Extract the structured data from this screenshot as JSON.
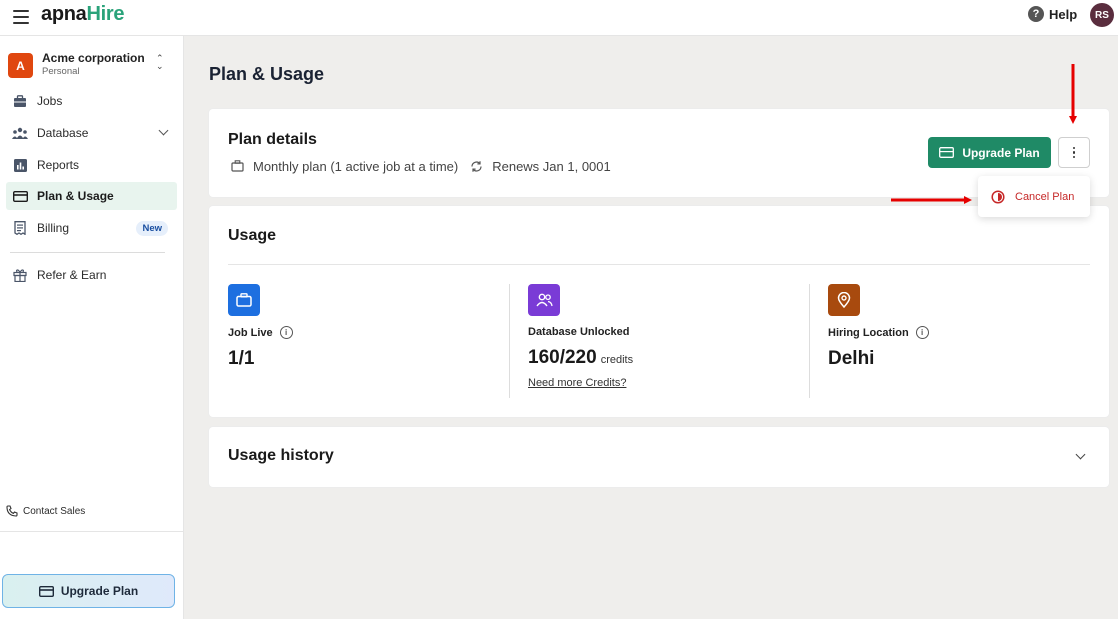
{
  "app": {
    "logo_prefix": "apna",
    "logo_suffix": "Hire",
    "help_label": "Help",
    "user_initials": "RS"
  },
  "sidebar": {
    "org": {
      "badge": "A",
      "name": "Acme corporation",
      "type": "Personal"
    },
    "items": [
      {
        "label": "Jobs",
        "icon": "briefcase-icon"
      },
      {
        "label": "Database",
        "icon": "people-icon"
      },
      {
        "label": "Reports",
        "icon": "bar-chart-icon"
      },
      {
        "label": "Plan & Usage",
        "icon": "credit-card-icon",
        "active": true
      },
      {
        "label": "Billing",
        "icon": "receipt-icon",
        "badge": "New"
      },
      {
        "label": "Refer & Earn",
        "icon": "gift-icon"
      }
    ],
    "contact_label": "Contact Sales",
    "upgrade_label": "Upgrade Plan"
  },
  "main": {
    "page_title": "Plan & Usage",
    "plan_details": {
      "title": "Plan details",
      "plan_text": "Monthly plan (1 active job at a time)",
      "renew_text": "Renews Jan 1, 0001",
      "upgrade_label": "Upgrade Plan",
      "menu": {
        "cancel_label": "Cancel Plan"
      }
    },
    "usage": {
      "title": "Usage",
      "items": [
        {
          "label": "Job Live",
          "value": "1/1",
          "color": "#1d6fe0",
          "icon": "briefcase-icon"
        },
        {
          "label": "Database Unlocked",
          "value": "160/220",
          "unit": "credits",
          "link": "Need more Credits?",
          "color": "#7a3bd6",
          "icon": "people-icon"
        },
        {
          "label": "Hiring Location",
          "value": "Delhi",
          "color": "#a84a0e",
          "icon": "location-pin-icon"
        }
      ]
    },
    "usage_history": {
      "title": "Usage history"
    }
  },
  "colors": {
    "brand_green": "#1f8a66",
    "logo_green": "#2aa37a",
    "danger": "#c62828",
    "annotation_arrow": "#e60000"
  }
}
